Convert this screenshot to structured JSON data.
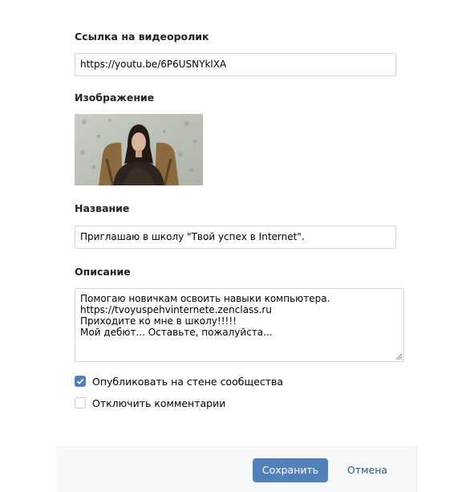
{
  "form": {
    "video_link_label": "Ссылка на видеоролик",
    "video_link_value": "https://youtu.be/6P6USNYklXA",
    "image_label": "Изображение",
    "title_label": "Название",
    "title_value": "Приглашаю в школу \"Твой успех в Internet\".",
    "description_label": "Описание",
    "description_lines": [
      "Помогаю новичкам освоить навыки компьютера.",
      "https://tvoyuspehvinternete.zenclass.ru",
      "Приходите ко мне в школу!!!!!",
      "Мой дебют... Оставьте, пожалуйста..."
    ],
    "publish_checkbox": {
      "label": "Опубликовать на стене сообщества",
      "checked": true
    },
    "comments_checkbox": {
      "label": "Отключить комментарии",
      "checked": false
    }
  },
  "footer": {
    "save_label": "Сохранить",
    "cancel_label": "Отмена"
  },
  "colors": {
    "accent": "#5181b8",
    "link": "#2a5885",
    "border": "#d3d9de",
    "footer_bg": "#f7f8fa"
  }
}
